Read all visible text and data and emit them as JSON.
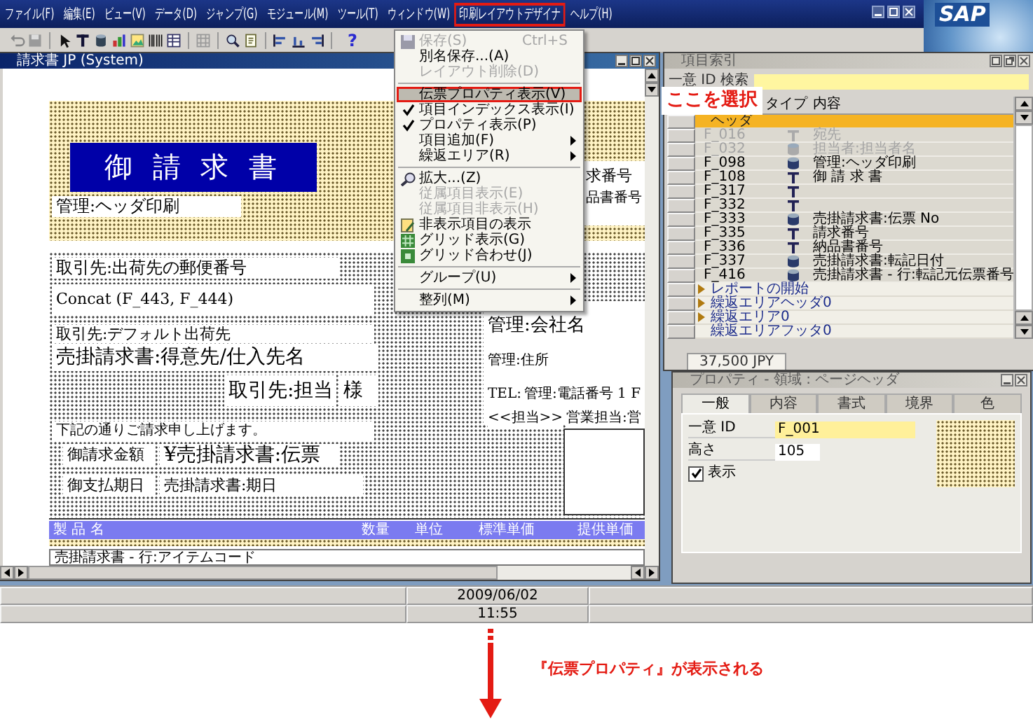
{
  "menu_bar": {
    "items": [
      {
        "label": "ファイル(F)",
        "selected": false
      },
      {
        "label": "編集(E)",
        "selected": false
      },
      {
        "label": "ビュー(V)",
        "selected": false
      },
      {
        "label": "データ(D)",
        "selected": false
      },
      {
        "label": "ジャンプ(G)",
        "selected": false
      },
      {
        "label": "モジュール(M)",
        "selected": false
      },
      {
        "label": "ツール(T)",
        "selected": false
      },
      {
        "label": "ウィンドウ(W)",
        "selected": false
      },
      {
        "label": "印刷レイアウトデザイナ",
        "selected": true
      },
      {
        "label": "ヘルプ(H)",
        "selected": false
      }
    ],
    "logo": "SAP"
  },
  "toolbar": {
    "help": "?"
  },
  "dropdown": {
    "items": [
      {
        "kind": "item",
        "label": "保存(S)",
        "shortcut": "Ctrl+S",
        "disabled": true,
        "checked": false,
        "selected": false,
        "submenu": false
      },
      {
        "kind": "item",
        "label": "別名保存...(A)",
        "disabled": false,
        "checked": false,
        "selected": false,
        "submenu": false
      },
      {
        "kind": "item",
        "label": "レイアウト削除(D)",
        "disabled": true,
        "checked": false,
        "selected": false,
        "submenu": false
      },
      {
        "kind": "separator"
      },
      {
        "kind": "item",
        "label": "伝票プロパティ表示(V)",
        "disabled": false,
        "checked": false,
        "selected": true,
        "submenu": false
      },
      {
        "kind": "item",
        "label": "項目インデックス表示(I)",
        "disabled": false,
        "checked": true,
        "selected": false,
        "submenu": false
      },
      {
        "kind": "item",
        "label": "プロパティ表示(P)",
        "disabled": false,
        "checked": true,
        "selected": false,
        "submenu": false
      },
      {
        "kind": "item",
        "label": "項目追加(F)",
        "disabled": false,
        "checked": false,
        "selected": false,
        "submenu": true
      },
      {
        "kind": "item",
        "label": "繰返エリア(R)",
        "disabled": false,
        "checked": false,
        "selected": false,
        "submenu": true
      },
      {
        "kind": "separator"
      },
      {
        "kind": "item",
        "label": "拡大...(Z)",
        "disabled": false,
        "checked": false,
        "selected": false,
        "submenu": false
      },
      {
        "kind": "item",
        "label": "従属項目表示(E)",
        "disabled": true,
        "checked": false,
        "selected": false,
        "submenu": false
      },
      {
        "kind": "item",
        "label": "従属項目非表示(H)",
        "disabled": true,
        "checked": false,
        "selected": false,
        "submenu": false
      },
      {
        "kind": "item",
        "label": "非表示項目の表示",
        "disabled": false,
        "checked": false,
        "selected": false,
        "submenu": false
      },
      {
        "kind": "item",
        "label": "グリッド表示(G)",
        "disabled": false,
        "checked": false,
        "selected": false,
        "submenu": false
      },
      {
        "kind": "item",
        "label": "グリッド合わせ(J)",
        "disabled": false,
        "checked": false,
        "selected": false,
        "submenu": false
      },
      {
        "kind": "separator"
      },
      {
        "kind": "item",
        "label": "グループ(U)",
        "disabled": false,
        "checked": false,
        "selected": false,
        "submenu": true
      },
      {
        "kind": "separator"
      },
      {
        "kind": "item",
        "label": "整列(M)",
        "disabled": false,
        "checked": false,
        "selected": false,
        "submenu": true
      }
    ]
  },
  "callout": {
    "text": "ここを選択"
  },
  "designer": {
    "title": "請求書 JP (System)",
    "fields": [
      {
        "kind": "banner",
        "text": "御 請 求 書"
      },
      {
        "kind": "field",
        "text": "管理:ヘッダ印刷"
      },
      {
        "kind": "bare",
        "text": "求番号"
      },
      {
        "kind": "bare",
        "text": "品書番号"
      },
      {
        "kind": "field",
        "text": "取引先:出荷先の郵便番号"
      },
      {
        "kind": "field",
        "text": "Concat (F_443, F_444)"
      },
      {
        "kind": "field",
        "text": "取引先:デフォルト出荷先"
      },
      {
        "kind": "field",
        "text": "売掛請求書:得意先/仕入先名"
      },
      {
        "kind": "field",
        "text": "取引先:担当"
      },
      {
        "kind": "field",
        "text": "様"
      },
      {
        "kind": "bare",
        "text": "管理:会社名"
      },
      {
        "kind": "bare",
        "text": "管理:住所"
      },
      {
        "kind": "bare",
        "text": "TEL:"
      },
      {
        "kind": "bare",
        "text": "管理:電話番号 1 F"
      },
      {
        "kind": "bare",
        "text": "<<担当>>"
      },
      {
        "kind": "bare",
        "text": "営業担当:営"
      },
      {
        "kind": "field",
        "text": "下記の通りご請求申し上げます。"
      },
      {
        "kind": "field",
        "text": "御請求金額"
      },
      {
        "kind": "field",
        "text": "¥売掛請求書:伝票"
      },
      {
        "kind": "field",
        "text": "御支払期日"
      },
      {
        "kind": "field",
        "text": "売掛請求書:期日"
      }
    ],
    "columns": [
      "製 品 名",
      "数量",
      "単位",
      "標準単価",
      "提供単価"
    ],
    "row": "売掛請求書 - 行:アイテムコード"
  },
  "item_index": {
    "title": "項目索引",
    "search_label": "一意 ID 検索",
    "columns": [
      "タイプ",
      "内容"
    ],
    "rows": [
      {
        "kind": "group",
        "label": "ヘッダ",
        "expandable": false,
        "disabled": false,
        "selected": true
      },
      {
        "kind": "text_item",
        "id": "F_016",
        "content": "宛先",
        "disabled": true,
        "selected": false
      },
      {
        "kind": "db_item",
        "id": "F_032",
        "content": "担当者:担当者名",
        "disabled": true,
        "selected": false
      },
      {
        "kind": "db_item",
        "id": "F_098",
        "content": "管理:ヘッダ印刷",
        "disabled": false,
        "selected": false
      },
      {
        "kind": "text_item",
        "id": "F_108",
        "content": "御 請 求 書",
        "disabled": false,
        "selected": false
      },
      {
        "kind": "text_item",
        "id": "F_317",
        "disabled": false,
        "selected": false
      },
      {
        "kind": "text_item",
        "id": "F_332",
        "disabled": false,
        "selected": false
      },
      {
        "kind": "db_item",
        "id": "F_333",
        "content": "売掛請求書:伝票 No",
        "disabled": false,
        "selected": false
      },
      {
        "kind": "text_item",
        "id": "F_335",
        "content": "請求番号",
        "disabled": false,
        "selected": false
      },
      {
        "kind": "text_item",
        "id": "F_336",
        "content": "納品書番号",
        "disabled": false,
        "selected": false
      },
      {
        "kind": "db_item",
        "id": "F_337",
        "content": "売掛請求書:転記日付",
        "disabled": false,
        "selected": false
      },
      {
        "kind": "db_item",
        "id": "F_416",
        "content": "売掛請求書 - 行:転記元伝票番号",
        "disabled": false,
        "selected": false
      },
      {
        "kind": "group",
        "label": "レポートの開始",
        "expandable": true,
        "disabled": false,
        "selected": false
      },
      {
        "kind": "group",
        "label": "繰返エリアヘッダ0",
        "expandable": true,
        "disabled": false,
        "selected": false
      },
      {
        "kind": "group",
        "label": "繰返エリア0",
        "expandable": true,
        "disabled": false,
        "selected": false
      },
      {
        "kind": "group",
        "label": "繰返エリアフッタ0",
        "expandable": false,
        "disabled": false,
        "selected": false
      }
    ],
    "footer": "37,500 JPY"
  },
  "properties": {
    "title": "プロパティ - 領域 : ページヘッダ",
    "tabs": [
      {
        "label": "一般",
        "selected": true
      },
      {
        "label": "内容",
        "selected": false
      },
      {
        "label": "書式",
        "selected": false
      },
      {
        "label": "境界",
        "selected": false
      },
      {
        "label": "色",
        "selected": false
      }
    ],
    "fields": [
      {
        "label": "一意 ID",
        "value": "F_001",
        "highlighted": true
      },
      {
        "label": "高さ",
        "value": "105",
        "highlighted": false
      }
    ],
    "checkbox": {
      "label": "表示",
      "checked": true
    }
  },
  "status_bar": {
    "date": "2009/06/02",
    "time": "11:55"
  },
  "caption": {
    "text": "『伝票プロパティ』が表示される"
  }
}
